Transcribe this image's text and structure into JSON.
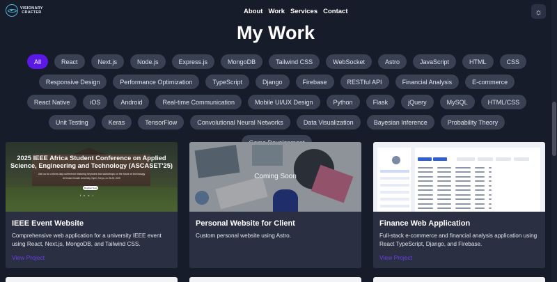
{
  "brand": {
    "logo_icon": "atom-icon",
    "name_line1": "VISIONARY",
    "name_line2": "CRAFTER"
  },
  "nav": {
    "items": [
      "About",
      "Work",
      "Services",
      "Contact"
    ]
  },
  "theme_toggle": {
    "icon": "sun-icon"
  },
  "page": {
    "title": "My Work"
  },
  "filters": {
    "active": "All",
    "items": [
      "All",
      "React",
      "Next.js",
      "Node.js",
      "Express.js",
      "MongoDB",
      "Tailwind CSS",
      "WebSocket",
      "Astro",
      "JavaScript",
      "HTML",
      "CSS",
      "Responsive Design",
      "Performance Optimization",
      "TypeScript",
      "Django",
      "Firebase",
      "RESTful API",
      "Financial Analysis",
      "E-commerce",
      "React Native",
      "iOS",
      "Android",
      "Real-time Communication",
      "Mobile UI/UX Design",
      "Python",
      "Flask",
      "jQuery",
      "MySQL",
      "HTML/CSS",
      "Unit Testing",
      "Keras",
      "TensorFlow",
      "Convolutional Neural Networks",
      "Data Visualization",
      "Bayesian Inference",
      "Probability Theory",
      "Game Development"
    ]
  },
  "projects": [
    {
      "title": "IEEE Event Website",
      "description": "Comprehensive web application for a university IEEE event using React, Next.js, MongoDB, and Tailwind CSS.",
      "link": "View Project",
      "image": {
        "heading": "2025 IEEE Africa Student Conference on Applied Science, Engineering and Technology (ASCASET'25)",
        "line1": "Join us for a three-day conference featuring keynotes and workshops on the future of technology",
        "line2": "At Dedan Kimathi University, Nyeri, Kenya, on 26-28, 2025",
        "button": "Register Now"
      }
    },
    {
      "title": "Personal Website for Client",
      "description": "Custom personal website using Astro.",
      "link": "",
      "image": {
        "overlay_text": "Coming Soon"
      }
    },
    {
      "title": "Finance Web Application",
      "description": "Full-stack e-commerce and financial analysis application using React TypeScript, Django, and Firebase.",
      "link": "View Project",
      "image": {
        "screen": "finance-dashboard-screenshot"
      }
    }
  ],
  "colors": {
    "background": "#171c2b",
    "card": "#2a3041",
    "chip": "#3a4152",
    "chip_active": "#5b18e6",
    "link": "#6d3df0"
  }
}
